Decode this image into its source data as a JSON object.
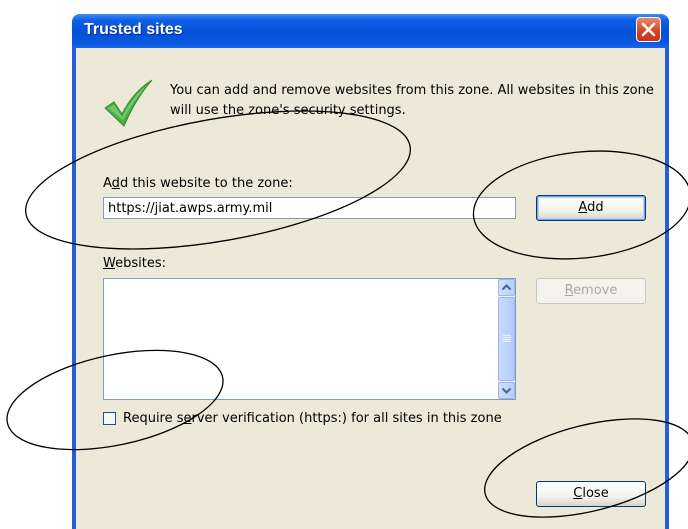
{
  "window": {
    "title": "Trusted sites"
  },
  "info": {
    "icon": "checkmark-icon",
    "description": "You can add and remove websites from this zone. All websites in this zone will use the zone's security settings."
  },
  "add_section": {
    "label_before": "A",
    "label_accel": "d",
    "label_after": "d this website to the zone:",
    "url_value": "https://jiat.awps.army.mil",
    "add_button_accel": "A",
    "add_button_rest": "dd"
  },
  "websites_section": {
    "label_accel": "W",
    "label_after": "ebsites:",
    "items": [],
    "remove_button_accel": "R",
    "remove_button_rest": "emove"
  },
  "verification": {
    "checked": false,
    "label_before": "Require s",
    "label_accel": "e",
    "label_after": "rver verification (https:) for all sites in this zone"
  },
  "footer": {
    "close_button_accel": "C",
    "close_button_rest": "lose"
  },
  "colors": {
    "titlebar": "#0550d8",
    "dialog_background": "#ece9d8",
    "close_button": "#d3421d",
    "checkmark": "#4bb043"
  }
}
